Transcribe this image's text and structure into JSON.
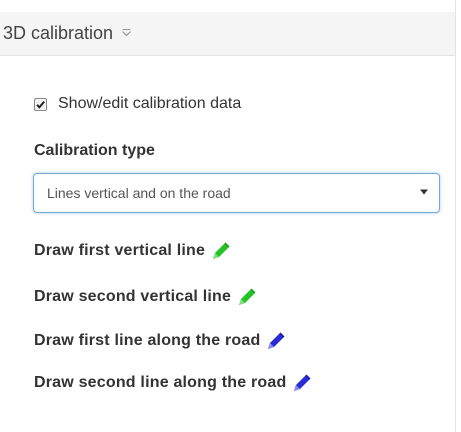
{
  "panel": {
    "title": "3D calibration",
    "caret_icon": "chevron-down-icon"
  },
  "show_calibration": {
    "label": "Show/edit calibration data",
    "checked": true
  },
  "calibration_type": {
    "label": "Calibration type",
    "selected": "Lines vertical and on the road"
  },
  "draw_items": [
    {
      "label": "Draw first vertical line",
      "icon": "pencil-icon",
      "color": "#22c322"
    },
    {
      "label": "Draw second vertical line",
      "icon": "pencil-icon",
      "color": "#22c322"
    },
    {
      "label": "Draw first line along the road",
      "icon": "pencil-icon",
      "color": "#2b2bd4"
    },
    {
      "label": "Draw second line along the road",
      "icon": "pencil-icon",
      "color": "#2b2bd4"
    }
  ]
}
